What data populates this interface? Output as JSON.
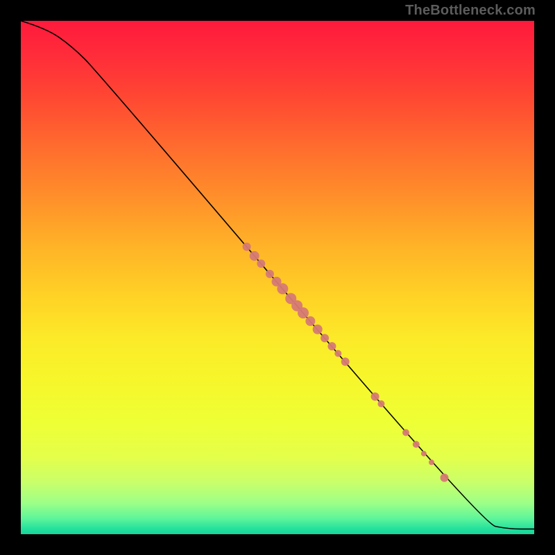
{
  "watermark": "TheBottleneck.com",
  "colors": {
    "marker": "#d67a74",
    "curve": "#000000"
  },
  "chart_data": {
    "type": "line",
    "title": "",
    "xlabel": "",
    "ylabel": "",
    "xlim": [
      0,
      100
    ],
    "ylim": [
      0,
      100
    ],
    "series": [
      {
        "name": "curve",
        "x": [
          0,
          5,
          10,
          15,
          90,
          95,
          100
        ],
        "y": [
          100,
          98.5,
          95,
          90,
          2,
          1,
          1
        ]
      }
    ],
    "markers": {
      "name": "cluster",
      "points": [
        {
          "x": 44.0,
          "y": 56.0,
          "r": 6
        },
        {
          "x": 45.5,
          "y": 54.2,
          "r": 7
        },
        {
          "x": 46.8,
          "y": 52.7,
          "r": 6
        },
        {
          "x": 48.5,
          "y": 50.7,
          "r": 6
        },
        {
          "x": 49.8,
          "y": 49.2,
          "r": 7
        },
        {
          "x": 51.0,
          "y": 47.8,
          "r": 8
        },
        {
          "x": 52.6,
          "y": 45.9,
          "r": 8
        },
        {
          "x": 53.8,
          "y": 44.5,
          "r": 8
        },
        {
          "x": 55.0,
          "y": 43.1,
          "r": 8
        },
        {
          "x": 56.4,
          "y": 41.5,
          "r": 7
        },
        {
          "x": 57.8,
          "y": 39.9,
          "r": 7
        },
        {
          "x": 59.2,
          "y": 38.2,
          "r": 6
        },
        {
          "x": 60.6,
          "y": 36.6,
          "r": 6
        },
        {
          "x": 61.8,
          "y": 35.2,
          "r": 5
        },
        {
          "x": 63.2,
          "y": 33.6,
          "r": 6
        },
        {
          "x": 69.0,
          "y": 26.8,
          "r": 6
        },
        {
          "x": 70.2,
          "y": 25.4,
          "r": 5
        },
        {
          "x": 75.0,
          "y": 19.8,
          "r": 5
        },
        {
          "x": 77.0,
          "y": 17.5,
          "r": 5
        },
        {
          "x": 78.5,
          "y": 15.7,
          "r": 4
        },
        {
          "x": 80.0,
          "y": 14.0,
          "r": 4
        },
        {
          "x": 82.5,
          "y": 11.0,
          "r": 6
        }
      ]
    }
  }
}
